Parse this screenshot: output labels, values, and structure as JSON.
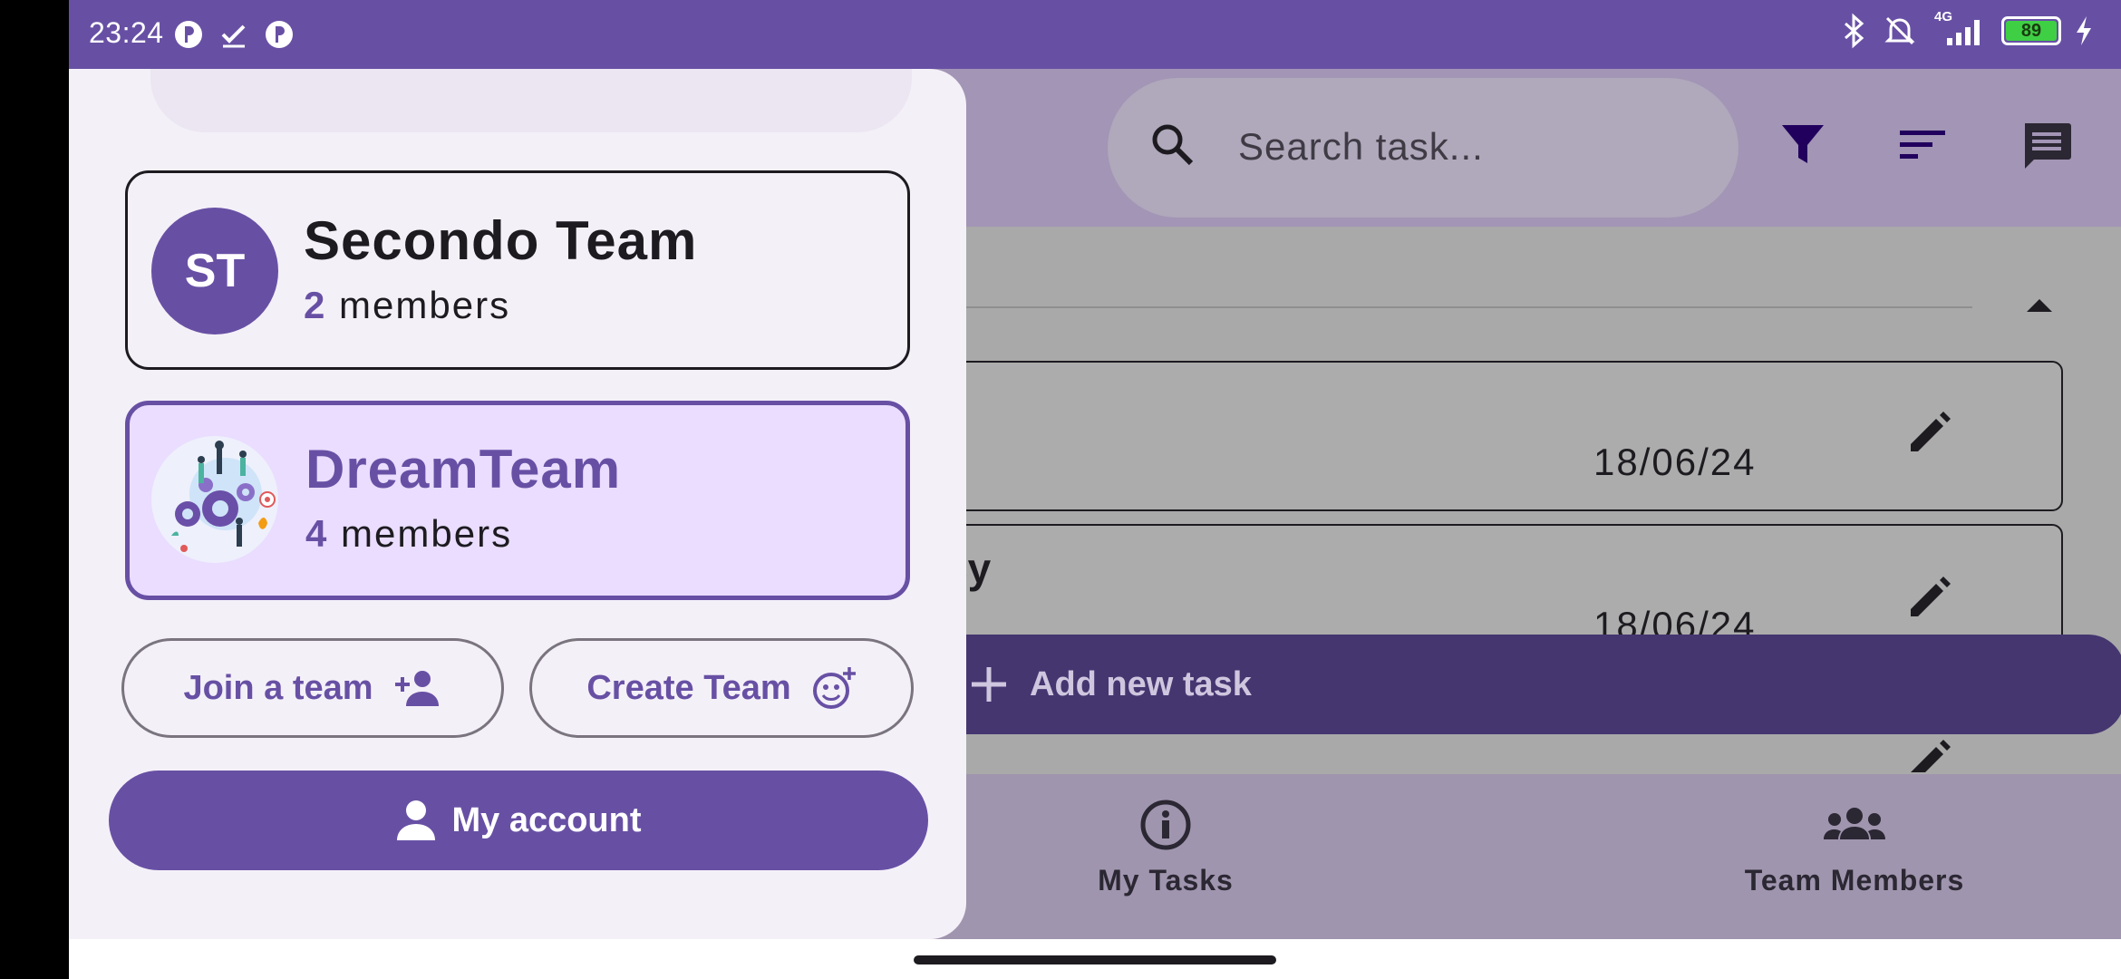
{
  "status_bar": {
    "time": "23:24",
    "battery_level": "89",
    "network": "4G",
    "left_icons": [
      "app-notification-icon",
      "check-icon",
      "app-notification-icon"
    ],
    "right_icons": [
      "bluetooth-icon",
      "bell-muted-icon",
      "signal-icon",
      "battery-icon",
      "charging-icon"
    ]
  },
  "header": {
    "search_placeholder": "Search task...",
    "icons": [
      "search-icon",
      "filter-icon",
      "sort-icon",
      "chat-icon"
    ]
  },
  "tasks": [
    {
      "title": "",
      "date": "18/06/24"
    },
    {
      "title": "cy",
      "date": "18/06/24"
    }
  ],
  "fab": {
    "label": "Add new task"
  },
  "bottom_nav": {
    "items": [
      {
        "label": "My Tasks",
        "icon": "info-icon"
      },
      {
        "label": "Team Members",
        "icon": "group-icon"
      }
    ]
  },
  "drawer": {
    "teams": [
      {
        "initials": "ST",
        "name": "Secondo Team",
        "member_count": "2",
        "member_word": "members",
        "selected": false
      },
      {
        "initials": "",
        "name": "DreamTeam",
        "member_count": "4",
        "member_word": "members",
        "selected": true
      }
    ],
    "join_label": "Join a team",
    "create_label": "Create Team",
    "account_label": "My account"
  },
  "colors": {
    "primary": "#6750a4",
    "primary_container": "#eaddff",
    "drawer_bg": "#f4f0f8",
    "fab": "#453670"
  }
}
